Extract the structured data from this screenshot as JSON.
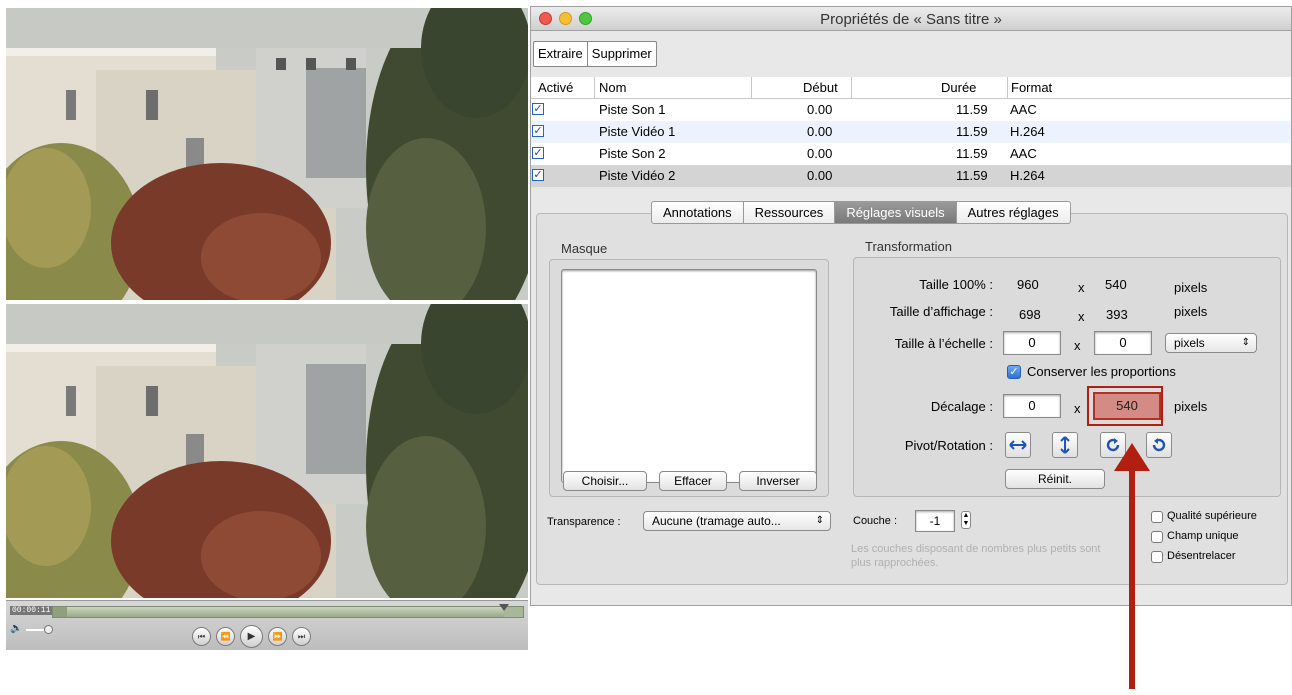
{
  "video": {
    "timecode": "00:00:11",
    "progress_fraction": 0.96,
    "played_fraction": 0.03,
    "icons": [
      "volume-icon",
      "go-to-start-icon",
      "rewind-icon",
      "play-icon",
      "fast-forward-icon",
      "go-to-end-icon"
    ]
  },
  "window": {
    "title": "Propriétés de « Sans titre »"
  },
  "toolbar": {
    "extract_label": "Extraire",
    "delete_label": "Supprimer"
  },
  "tracks": {
    "columns": [
      "Activé",
      "Nom",
      "Début",
      "Durée",
      "Format"
    ],
    "rows": [
      {
        "enabled": true,
        "name": "Piste Son 1",
        "start": "0.00",
        "duration": "11.59",
        "format": "AAC"
      },
      {
        "enabled": true,
        "name": "Piste Vidéo 1",
        "start": "0.00",
        "duration": "11.59",
        "format": "H.264"
      },
      {
        "enabled": true,
        "name": "Piste Son 2",
        "start": "0.00",
        "duration": "11.59",
        "format": "AAC"
      },
      {
        "enabled": true,
        "name": "Piste Vidéo 2",
        "start": "0.00",
        "duration": "11.59",
        "format": "H.264"
      }
    ]
  },
  "tabs": [
    "Annotations",
    "Ressources",
    "Réglages visuels",
    "Autres réglages"
  ],
  "active_tab": "Réglages visuels",
  "mask": {
    "title": "Masque",
    "choose_label": "Choisir...",
    "clear_label": "Effacer",
    "invert_label": "Inverser"
  },
  "transparency": {
    "label": "Transparence :",
    "value": "Aucune (tramage auto..."
  },
  "transform": {
    "title": "Transformation",
    "size100_label": "Taille 100% :",
    "size100_w": "960",
    "size100_h": "540",
    "display_label": "Taille d’affichage :",
    "display_w": "698",
    "display_h": "393",
    "scale_label": "Taille à l’échelle :",
    "scale_w": "0",
    "scale_h": "0",
    "unit_popup": "pixels",
    "keep_ratio_label": "Conserver les proportions",
    "keep_ratio_checked": true,
    "offset_label": "Décalage :",
    "offset_x": "0",
    "offset_y": "540",
    "pixels": "pixels",
    "times": "x",
    "pivot_label": "Pivot/Rotation :",
    "reset_label": "Réinit."
  },
  "layer": {
    "label": "Couche :",
    "value": "-1",
    "hint": "Les couches disposant de nombres plus petits sont plus rapprochées."
  },
  "options": {
    "high_quality": "Qualité supérieure",
    "single_field": "Champ unique",
    "deinterlace": "Désentrelacer"
  },
  "colors": {
    "highlight_border": "#b01f10",
    "highlight_fill": "#d48b86",
    "active_tab": "#8a8a8a"
  }
}
